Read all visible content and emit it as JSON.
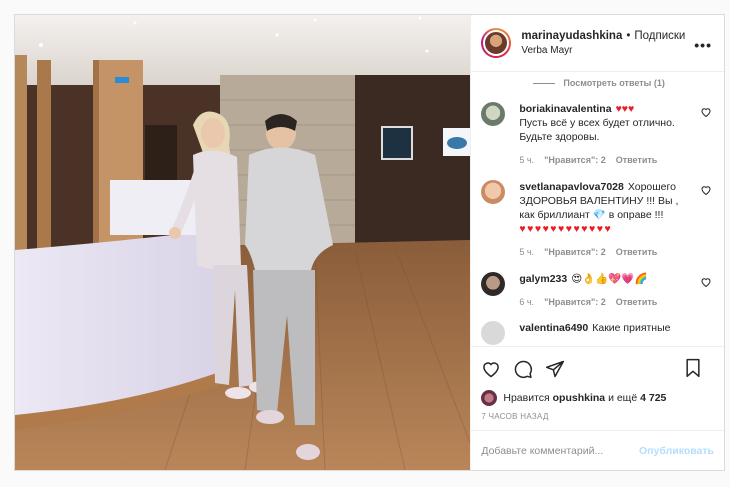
{
  "post": {
    "username": "marinayudashkina",
    "separator": "•",
    "follow_label": "Подписки",
    "location": "Verba Mayr",
    "more_icon": "more-icon"
  },
  "comments": {
    "view_replies": "Посмотреть ответы (1)",
    "items": [
      {
        "user": "boriakinavalentina",
        "text_before": "",
        "hearts_inline": "♥♥♥",
        "text": "Пусть всё у всех будет отлично. Будьте здоровы.",
        "age": "5 ч.",
        "likes": "\"Нравится\": 2",
        "reply": "Ответить"
      },
      {
        "user": "svetlanapavlova7028",
        "text": "Хорошего ЗДОРОВЬЯ ВАЛЕНТИНУ !!! Вы , как бриллиант 💎 в оправе !!!",
        "hearts": "♥♥♥♥♥♥♥♥♥♥♥♥",
        "age": "5 ч.",
        "likes": "\"Нравится\": 2",
        "reply": "Ответить"
      },
      {
        "user": "galym233",
        "text": "😍👌👍💖💗🌈",
        "age": "6 ч.",
        "likes": "\"Нравится\": 2",
        "reply": "Ответить"
      },
      {
        "user": "valentina6490",
        "text": "Какие приятные"
      }
    ]
  },
  "likes": {
    "prefix": "Нравится",
    "user": "opushkina",
    "suffix": "и ещё",
    "count": "4 725"
  },
  "timestamp": "7 ЧАСОВ НАЗАД",
  "comment_box": {
    "placeholder": "Добавьте комментарий...",
    "publish": "Опубликовать"
  },
  "colors": {
    "heart_red": "#ed1c24",
    "publish_disabled": "#b2dffc",
    "muted": "#8e8e8e"
  }
}
